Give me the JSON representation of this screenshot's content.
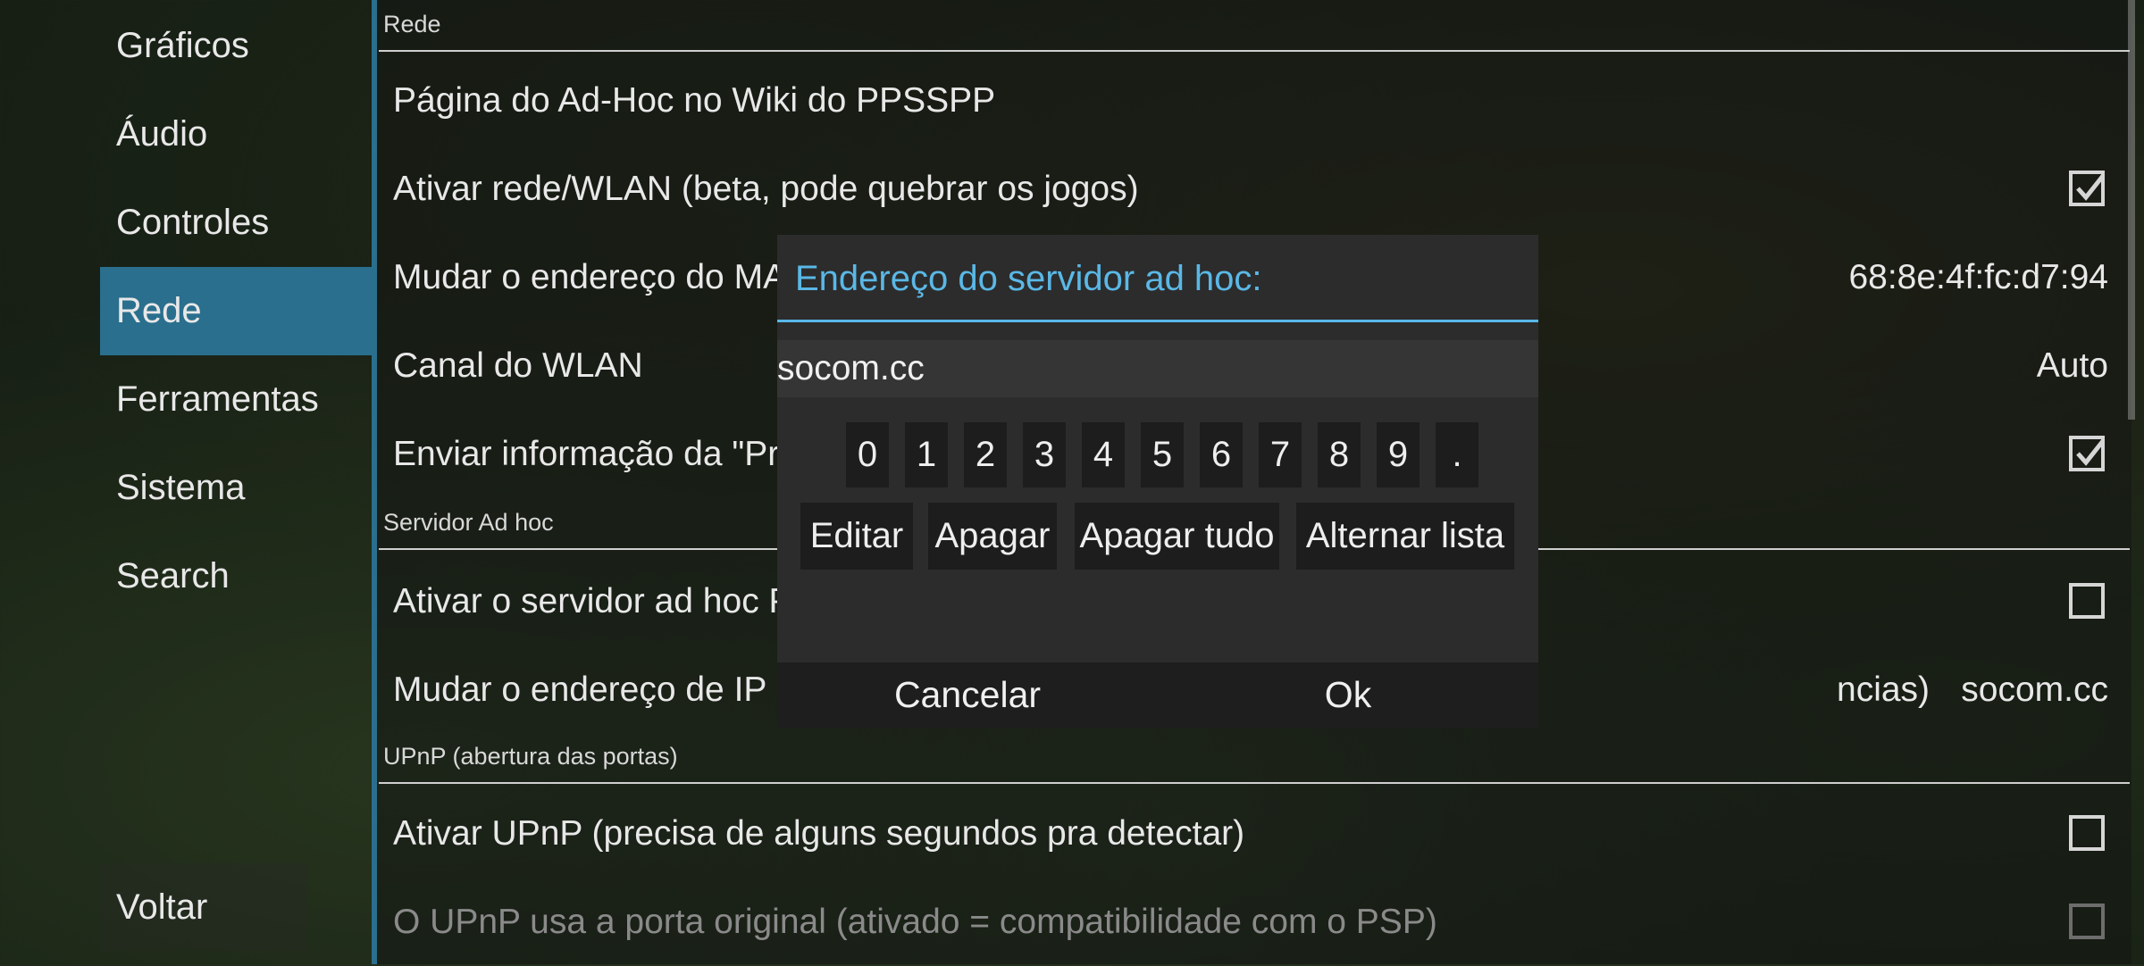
{
  "sidebar": {
    "items": [
      {
        "label": "Gráficos"
      },
      {
        "label": "Áudio"
      },
      {
        "label": "Controles"
      },
      {
        "label": "Rede"
      },
      {
        "label": "Ferramentas"
      },
      {
        "label": "Sistema"
      },
      {
        "label": "Search"
      }
    ],
    "active": "Rede",
    "back_label": "Voltar"
  },
  "sections": {
    "rede": "Rede",
    "servidor": "Servidor Ad hoc",
    "upnp": "UPnP (abertura das portas)"
  },
  "rows": {
    "wiki": {
      "label": "Página do Ad-Hoc no Wiki do PPSSPP"
    },
    "wlan": {
      "label": "Ativar rede/WLAN (beta, pode quebrar os jogos)",
      "checked": true
    },
    "mac": {
      "label": "Mudar o endereço do MAC",
      "value": "68:8e:4f:fc:d7:94"
    },
    "canal": {
      "label": "Canal do WLAN",
      "value": "Auto"
    },
    "presence": {
      "label": "Enviar informação da \"Pre",
      "checked": true
    },
    "adhoc_server": {
      "label": "Ativar o servidor ad hoc P",
      "checked": false
    },
    "ip": {
      "label": "Mudar o endereço de IP do",
      "label_tail": "ncias)",
      "value": "socom.cc"
    },
    "upnp_enable": {
      "label": "Ativar UPnP (precisa de alguns segundos pra detectar)",
      "checked": false
    },
    "upnp_port": {
      "label": "O UPnP usa a porta original (ativado = compatibilidade com o PSP)",
      "checked": false,
      "disabled": true
    }
  },
  "dialog": {
    "title": "Endereço do servidor ad hoc:",
    "input_value": "socom.cc",
    "keys": [
      "0",
      "1",
      "2",
      "3",
      "4",
      "5",
      "6",
      "7",
      "8",
      "9",
      "."
    ],
    "actions": [
      "Editar",
      "Apagar",
      "Apagar tudo",
      "Alternar lista"
    ],
    "cancel_label": "Cancelar",
    "ok_label": "Ok"
  },
  "colors": {
    "accent": "#2a6f8e",
    "dialog_title": "#5ab8e6"
  }
}
